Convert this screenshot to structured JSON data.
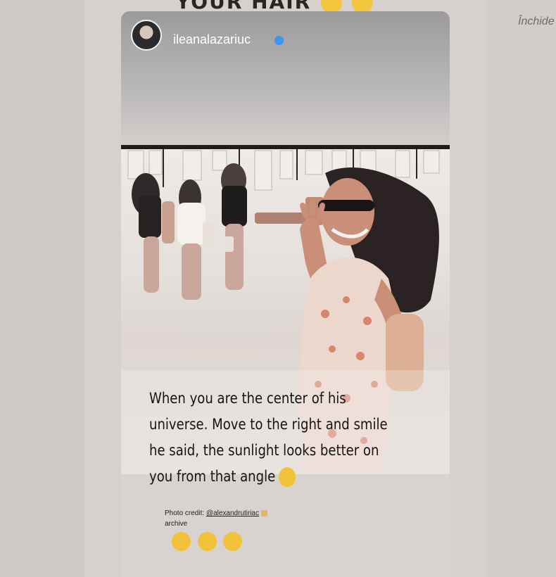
{
  "page": {
    "close_label": "Închide",
    "top_heading": "YOUR HAIR"
  },
  "story": {
    "username": "ileanalazariuc",
    "verified": true,
    "caption_lines": [
      "When you are the center of his",
      "universe. Move  to the right and smile",
      "he said, the sunlight looks better on",
      "you from that angle"
    ],
    "credit_prefix": "Photo credit:",
    "credit_handle": "@alexandrutiriac",
    "credit_suffix": "archive",
    "icons": {
      "avatar": "profile-photo",
      "verified": "verified-badge-icon",
      "caption_emoji": "hugging-face-emoji",
      "reaction_emojis": [
        "rolling-laughing-emoji",
        "rolling-laughing-emoji",
        "rolling-laughing-emoji"
      ]
    }
  },
  "colors": {
    "background": "#d4ceca",
    "verified_blue": "#3a96f0",
    "username_text": "#ffffff",
    "caption_text": "#141414"
  }
}
